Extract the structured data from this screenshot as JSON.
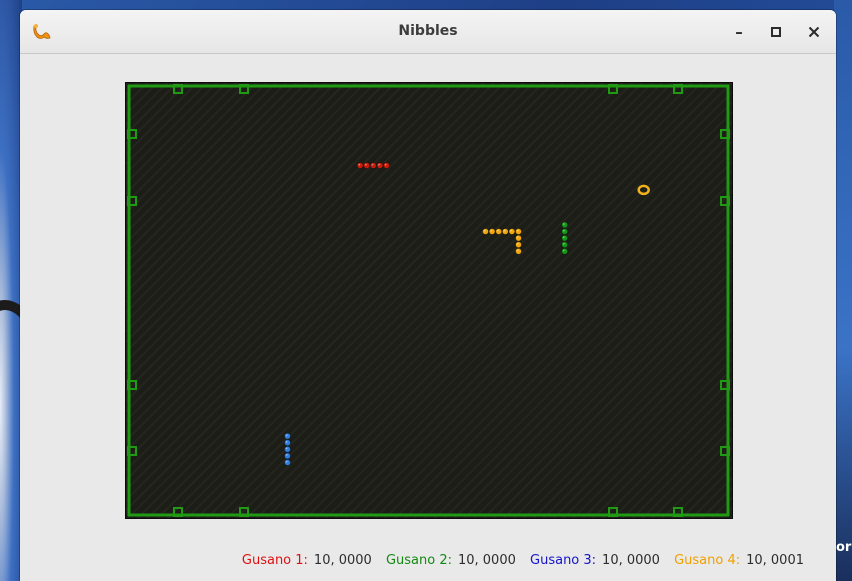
{
  "window": {
    "title": "Nibbles",
    "minimize_symbol": "–",
    "maximize_symbol": "□",
    "close_symbol": "✕",
    "app_icon": "nibbles-worm-icon"
  },
  "desktop": {
    "edge_text": "or"
  },
  "board": {
    "background": "#1b1d16",
    "wall_color": "#1f9a12",
    "bonus_ring": {
      "color": "#f0b11b",
      "cell": [
        84,
        16
      ]
    },
    "worms": [
      {
        "name": "Gusano 1",
        "color": "#c81c0c",
        "cells": [
          [
            38,
            12
          ],
          [
            39,
            12
          ],
          [
            40,
            12
          ],
          [
            41,
            12
          ],
          [
            42,
            12
          ]
        ]
      },
      {
        "name": "Gusano 2",
        "color": "#15961a",
        "cells": [
          [
            69,
            21
          ],
          [
            69,
            22
          ],
          [
            69,
            23
          ],
          [
            69,
            24
          ],
          [
            69,
            25
          ]
        ]
      },
      {
        "name": "Gusano 3",
        "color": "#2d7fe6",
        "cells": [
          [
            27,
            53
          ],
          [
            27,
            54
          ],
          [
            27,
            55
          ],
          [
            27,
            56
          ],
          [
            27,
            57
          ]
        ]
      },
      {
        "name": "Gusano 4",
        "color": "#f0a70f",
        "cells": [
          [
            57,
            22
          ],
          [
            58,
            22
          ],
          [
            59,
            22
          ],
          [
            60,
            22
          ],
          [
            61,
            22
          ],
          [
            62,
            22
          ],
          [
            62,
            23
          ],
          [
            62,
            24
          ],
          [
            62,
            25
          ]
        ]
      }
    ]
  },
  "scores": [
    {
      "label": "Gusano 1:",
      "value": "10, 0000",
      "color": "#e01010"
    },
    {
      "label": "Gusano 2:",
      "value": "10, 0000",
      "color": "#138a12"
    },
    {
      "label": "Gusano 3:",
      "value": "10, 0000",
      "color": "#1414c8"
    },
    {
      "label": "Gusano 4:",
      "value": "10, 0001",
      "color": "#f0a000"
    }
  ]
}
